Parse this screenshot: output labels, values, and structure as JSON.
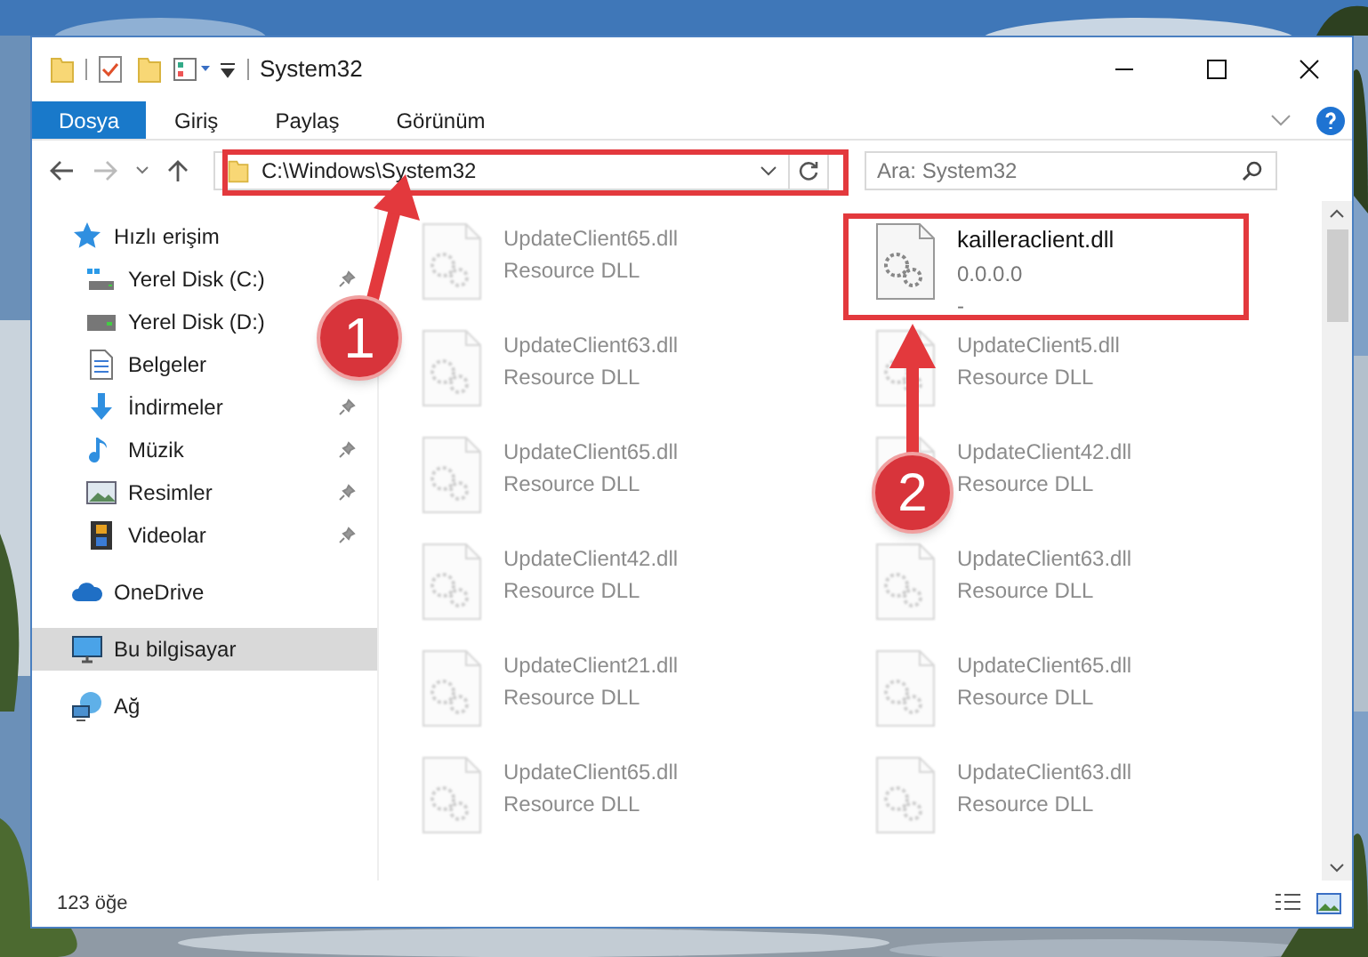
{
  "window": {
    "title": "System32"
  },
  "ribbon_tabs": [
    {
      "label": "Dosya",
      "kind": "file"
    },
    {
      "label": "Giriş",
      "kind": "tab"
    },
    {
      "label": "Paylaş",
      "kind": "tab"
    },
    {
      "label": "Görünüm",
      "kind": "tab"
    }
  ],
  "address_bar": {
    "path": "C:\\Windows\\System32"
  },
  "search": {
    "placeholder": "Ara: System32"
  },
  "sidebar": {
    "items": [
      {
        "label": "Hızlı erişim",
        "kind": "star",
        "selected": false,
        "children": [
          {
            "label": "Yerel Disk (C:)",
            "kind": "drive-win",
            "pinned": true,
            "selected": false
          },
          {
            "label": "Yerel Disk (D:)",
            "kind": "drive",
            "selected": false
          },
          {
            "label": "Belgeler",
            "kind": "doc",
            "selected": false
          },
          {
            "label": "İndirmeler",
            "kind": "download",
            "pinned": true,
            "selected": false
          },
          {
            "label": "Müzik",
            "kind": "music",
            "pinned": true,
            "selected": false
          },
          {
            "label": "Resimler",
            "pinned": true,
            "selected": false
          },
          {
            "label": "Videolar",
            "kind": "video",
            "pinned": true,
            "selected": false
          }
        ]
      },
      {
        "label": "OneDrive",
        "kind": "cloud",
        "selected": false
      },
      {
        "label": "Bu bilgisayar",
        "kind": "pc",
        "selected": true
      },
      {
        "label": "Ağ",
        "kind": "network",
        "selected": false
      }
    ]
  },
  "files": [
    {
      "name": "UpdateClient65.dll",
      "lines": [
        "Resource DLL"
      ],
      "blurred": true
    },
    {
      "name": "kailleraclient.dll",
      "lines": [
        "0.0.0.0",
        "-"
      ],
      "blurred": false
    },
    {
      "name": "UpdateClient63.dll",
      "lines": [
        "Resource DLL"
      ],
      "blurred": true
    },
    {
      "name": "UpdateClient5.dll",
      "lines": [
        "Resource DLL"
      ],
      "blurred": true
    },
    {
      "name": "UpdateClient65.dll",
      "lines": [
        "Resource DLL"
      ],
      "blurred": true
    },
    {
      "name": "UpdateClient42.dll",
      "lines": [
        "Resource DLL"
      ],
      "blurred": true
    },
    {
      "name": "UpdateClient42.dll",
      "lines": [
        "Resource DLL"
      ],
      "blurred": true
    },
    {
      "name": "UpdateClient63.dll",
      "lines": [
        "Resource DLL"
      ],
      "blurred": true
    },
    {
      "name": "UpdateClient21.dll",
      "lines": [
        "Resource DLL"
      ],
      "blurred": true
    },
    {
      "name": "UpdateClient65.dll",
      "lines": [
        "Resource DLL"
      ],
      "blurred": true
    },
    {
      "name": "UpdateClient65.dll",
      "lines": [
        "Resource DLL"
      ],
      "blurred": true
    },
    {
      "name": "UpdateClient63.dll",
      "lines": [
        "Resource DLL"
      ],
      "blurred": true
    }
  ],
  "status_bar": {
    "count": "123 öğe"
  },
  "annotations": [
    {
      "number": "1"
    },
    {
      "number": "2"
    }
  ]
}
